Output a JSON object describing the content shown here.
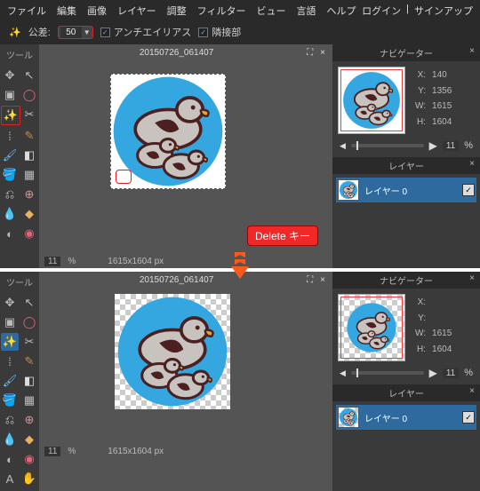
{
  "menubar": {
    "items": [
      "ファイル",
      "編集",
      "画像",
      "レイヤー",
      "調整",
      "フィルター",
      "ビュー",
      "言語",
      "ヘルプ"
    ],
    "login": "ログイン",
    "signup": "サインアップ",
    "sep": "|"
  },
  "optionsbar": {
    "tolerance_label": "公差:",
    "tolerance_value": "50",
    "antialias": "アンチエイリアス",
    "contiguous": "隣接部"
  },
  "toolbox": {
    "title": "ツール"
  },
  "tab": {
    "title": "20150726_061407",
    "expand_icon": "⛶",
    "close_icon": "×"
  },
  "status": {
    "zoom": "11",
    "percent": "%",
    "dims": "1615x1604 px"
  },
  "annotation": {
    "delete_key": "Delete キー"
  },
  "navigator": {
    "title": "ナビゲーター",
    "before": {
      "X": "140",
      "Y": "1356",
      "W": "1615",
      "H": "1604"
    },
    "after": {
      "X": "",
      "Y": "",
      "W": "1615",
      "H": "1604"
    },
    "zoom_val": "11",
    "percent": "%"
  },
  "layers": {
    "title": "レイヤー",
    "row": {
      "name": "レイヤー 0"
    }
  },
  "icons": {
    "check": "✓"
  }
}
